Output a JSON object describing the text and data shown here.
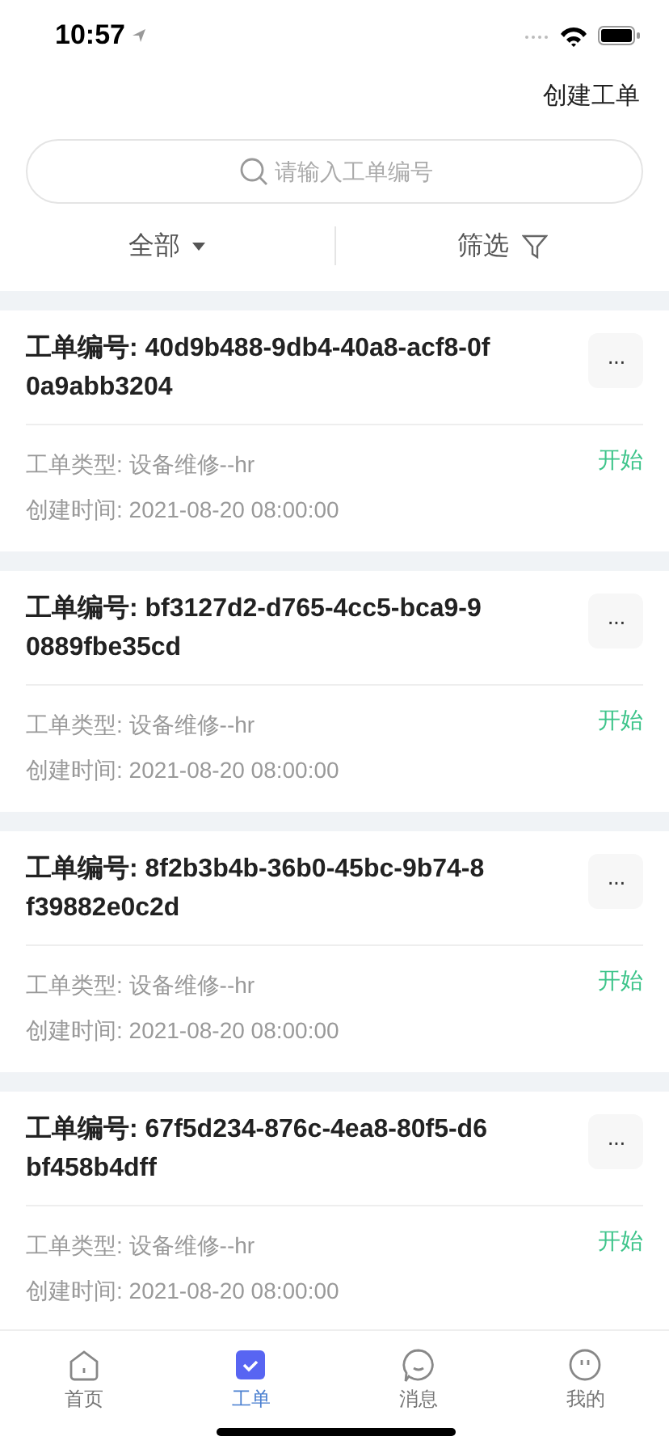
{
  "status_bar": {
    "time": "10:57"
  },
  "header": {
    "action": "创建工单"
  },
  "search": {
    "placeholder": "请输入工单编号"
  },
  "filters": [
    {
      "label": "全部",
      "kind": "dropdown"
    },
    {
      "label": "筛选",
      "kind": "filter"
    }
  ],
  "orders": [
    {
      "title": "工单编号: 40d9b488-9db4-40a8-acf8-0f0a9abb3204",
      "type": "工单类型: 设备维修--hr",
      "created": "创建时间: 2021-08-20 08:00:00",
      "action": "开始",
      "menu": "···"
    },
    {
      "title": "工单编号: bf3127d2-d765-4cc5-bca9-90889fbe35cd",
      "type": "工单类型: 设备维修--hr",
      "created": "创建时间: 2021-08-20 08:00:00",
      "action": "开始",
      "menu": "···"
    },
    {
      "title": "工单编号: 8f2b3b4b-36b0-45bc-9b74-8f39882e0c2d",
      "type": "工单类型: 设备维修--hr",
      "created": "创建时间: 2021-08-20 08:00:00",
      "action": "开始",
      "menu": "···"
    },
    {
      "title": "工单编号: 67f5d234-876c-4ea8-80f5-d6bf458b4dff",
      "type": "工单类型: 设备维修--hr",
      "created": "创建时间: 2021-08-20 08:00:00",
      "action": "开始",
      "menu": "···"
    }
  ],
  "tab_bar": [
    {
      "label": "首页",
      "kind": "home",
      "selected": false
    },
    {
      "label": "工单",
      "kind": "orders",
      "selected": true
    },
    {
      "label": "消息",
      "kind": "messages",
      "selected": false
    },
    {
      "label": "我的",
      "kind": "profile",
      "selected": false
    }
  ]
}
